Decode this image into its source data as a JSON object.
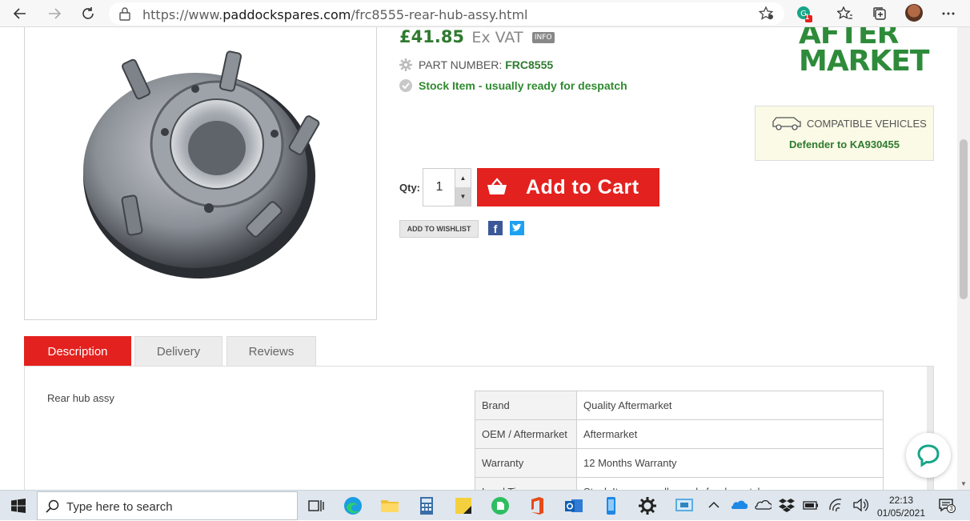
{
  "browser": {
    "url_prefix": "https://www.",
    "url_domain": "paddockspares.com",
    "url_path": "/frc8555-rear-hub-assy.html",
    "profile_badge": "1"
  },
  "product": {
    "price": "£41.85",
    "price_suffix": "Ex VAT",
    "info_badge": "INFO",
    "part_number_label": "PART NUMBER:",
    "part_number": "FRC8555",
    "stock_status": "Stock Item - usually ready for despatch",
    "qty_label": "Qty:",
    "qty_value": "1",
    "add_to_cart": "Add to Cart",
    "wishlist": "ADD TO WISHLIST"
  },
  "brand_logo": {
    "line1": "AFTER",
    "line2": "MARKET"
  },
  "compatibility": {
    "heading": "COMPATIBLE VEHICLES",
    "vehicle": "Defender to KA930455"
  },
  "tabs": [
    {
      "label": "Description",
      "active": true
    },
    {
      "label": "Delivery",
      "active": false
    },
    {
      "label": "Reviews",
      "active": false
    }
  ],
  "description": {
    "text": "Rear hub assy",
    "specs": [
      {
        "key": "Brand",
        "value": "Quality Aftermarket"
      },
      {
        "key": "OEM / Aftermarket",
        "value": "Aftermarket"
      },
      {
        "key": "Warranty",
        "value": "12 Months Warranty"
      },
      {
        "key": "Lead Time",
        "value": "Stock Item - usually ready for despatch"
      }
    ]
  },
  "taskbar": {
    "search_placeholder": "Type here to search",
    "time": "22:13",
    "date": "01/05/2021",
    "notification_count": "3"
  },
  "colors": {
    "accent_red": "#e3211e",
    "price_green": "#2f7a2f",
    "logo_green": "#2e8b3a"
  }
}
